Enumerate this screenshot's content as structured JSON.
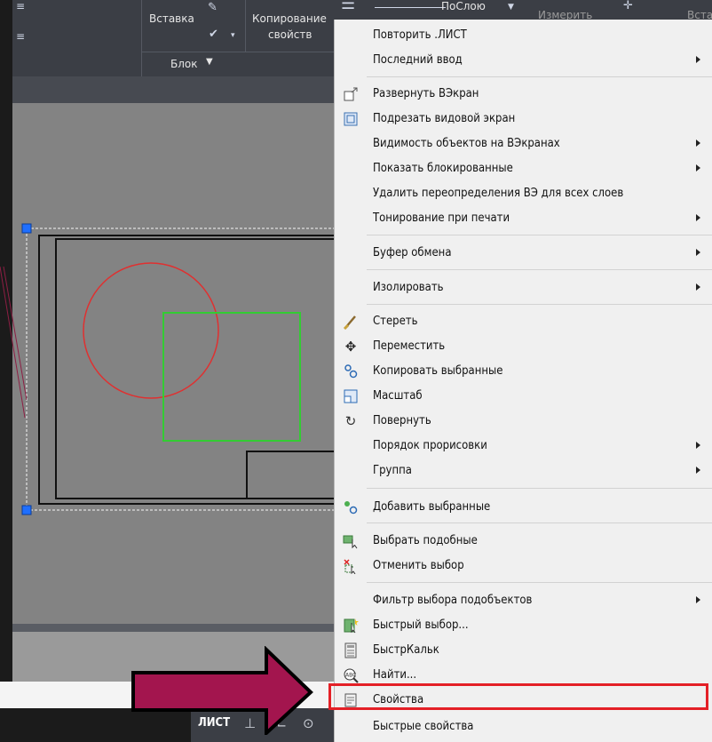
{
  "ribbon": {
    "insert_label": "Вставка",
    "copy_props_line1": "Копирование",
    "copy_props_line2": "свойств",
    "block_panel_label": "Блок",
    "layer_value": "ПоСлою",
    "measure_label": "Измерить",
    "insert2_label": "Вставить"
  },
  "status": {
    "layout_tab": "ЛИСТ"
  },
  "menu": {
    "items": [
      {
        "label": "Повторить .ЛИСТ",
        "submenu": false,
        "icon": ""
      },
      {
        "label": "Последний ввод",
        "submenu": true,
        "icon": ""
      },
      {
        "label": "Развернуть ВЭкран",
        "submenu": false,
        "icon": "maximize-viewport-icon"
      },
      {
        "label": "Подрезать видовой экран",
        "submenu": false,
        "icon": "clip-viewport-icon"
      },
      {
        "label": "Видимость объектов на ВЭкранах",
        "submenu": true,
        "icon": ""
      },
      {
        "label": "Показать блокированные",
        "submenu": true,
        "icon": ""
      },
      {
        "label": "Удалить переопределения ВЭ для всех слоев",
        "submenu": false,
        "icon": ""
      },
      {
        "label": "Тонирование при печати",
        "submenu": true,
        "icon": ""
      },
      {
        "label": "Буфер обмена",
        "submenu": true,
        "icon": ""
      },
      {
        "label": "Изолировать",
        "submenu": true,
        "icon": ""
      },
      {
        "label": "Стереть",
        "submenu": false,
        "icon": "erase-icon"
      },
      {
        "label": "Переместить",
        "submenu": false,
        "icon": "move-icon"
      },
      {
        "label": "Копировать выбранные",
        "submenu": false,
        "icon": "copy-icon"
      },
      {
        "label": "Масштаб",
        "submenu": false,
        "icon": "scale-icon"
      },
      {
        "label": "Повернуть",
        "submenu": false,
        "icon": "rotate-icon"
      },
      {
        "label": "Порядок прорисовки",
        "submenu": true,
        "icon": ""
      },
      {
        "label": "Группа",
        "submenu": true,
        "icon": ""
      },
      {
        "label": "Добавить выбранные",
        "submenu": false,
        "icon": "add-selected-icon"
      },
      {
        "label": "Выбрать подобные",
        "submenu": false,
        "icon": "select-similar-icon"
      },
      {
        "label": "Отменить выбор",
        "submenu": false,
        "icon": "deselect-icon"
      },
      {
        "label": "Фильтр выбора подобъектов",
        "submenu": true,
        "icon": ""
      },
      {
        "label": "Быстрый выбор...",
        "submenu": false,
        "icon": "quick-select-icon"
      },
      {
        "label": "БыстрКальк",
        "submenu": false,
        "icon": "calculator-icon"
      },
      {
        "label": "Найти...",
        "submenu": false,
        "icon": "find-icon"
      },
      {
        "label": "Свойства",
        "submenu": false,
        "icon": "properties-icon"
      },
      {
        "label": "Быстрые свойства",
        "submenu": false,
        "icon": ""
      }
    ]
  },
  "colors": {
    "highlight": "#e42027",
    "arrow": "#a3154e",
    "circle": "#e03030",
    "rect": "#33cc33"
  }
}
